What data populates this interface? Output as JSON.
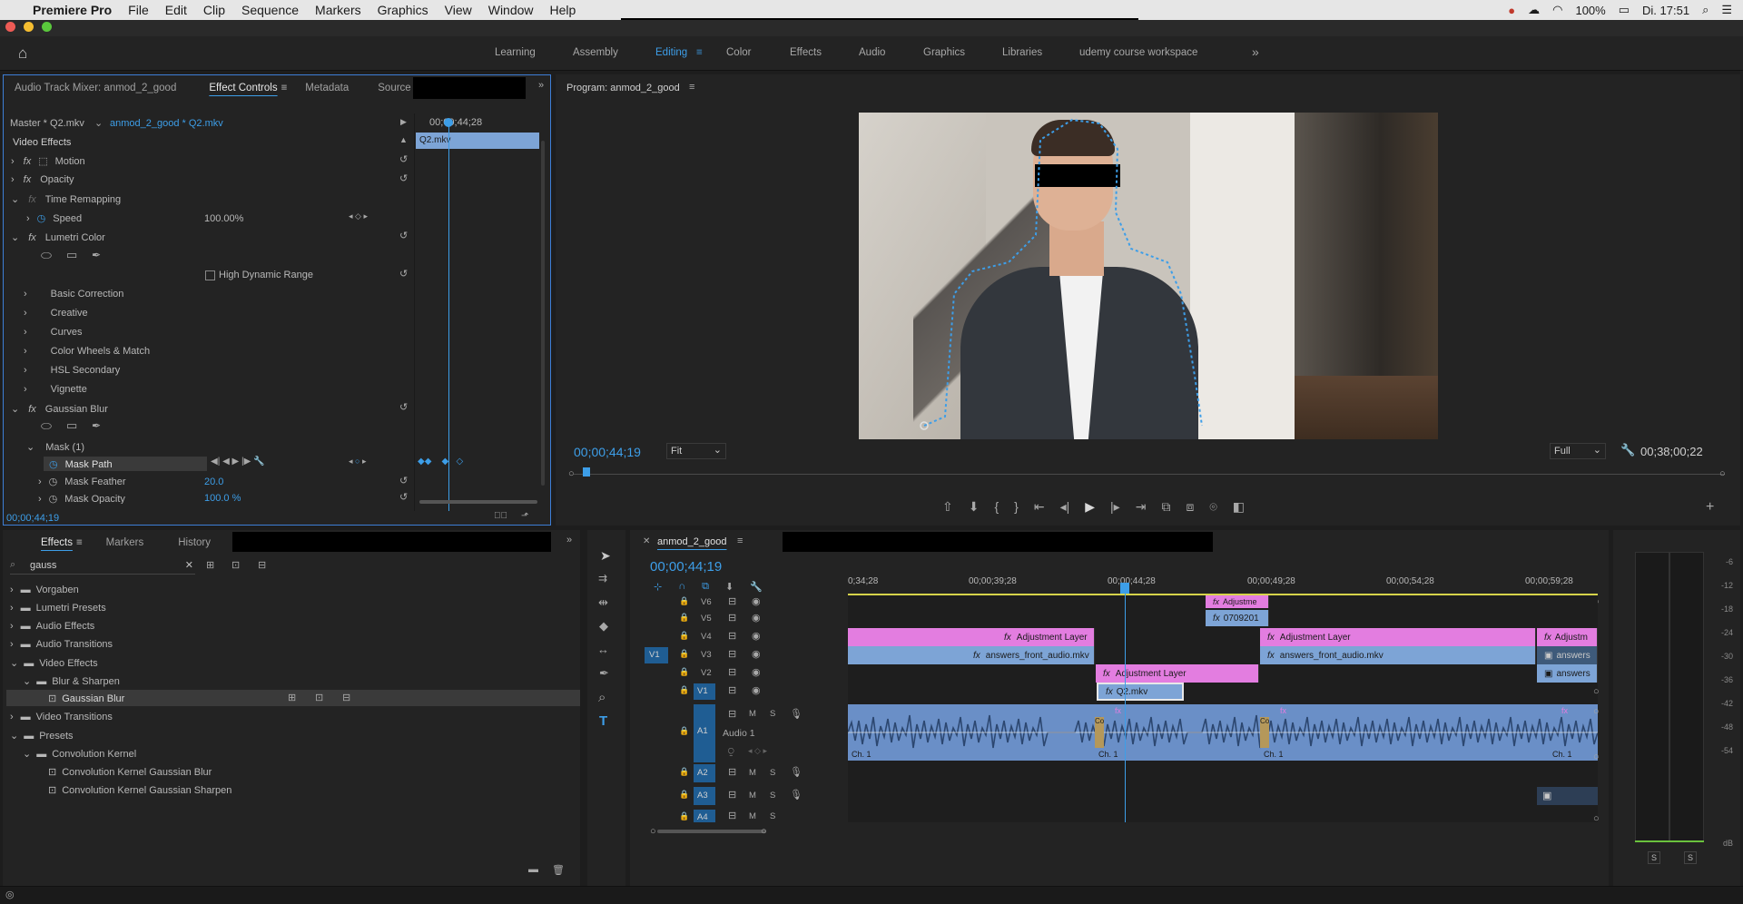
{
  "menubar": {
    "app_name": "Premiere Pro",
    "items": [
      "File",
      "Edit",
      "Clip",
      "Sequence",
      "Markers",
      "Graphics",
      "View",
      "Window",
      "Help"
    ],
    "battery": "100%",
    "clock": "Di. 17:51"
  },
  "workspaces": {
    "items": [
      "Learning",
      "Assembly",
      "Editing",
      "Color",
      "Effects",
      "Audio",
      "Graphics",
      "Libraries",
      "udemy course workspace"
    ],
    "active": "Editing",
    "more": "»"
  },
  "effect_controls": {
    "tabs": [
      "Audio Track Mixer: anmod_2_good",
      "Effect Controls",
      "Metadata",
      "Source"
    ],
    "master_label": "Master * Q2.mkv",
    "clip_label": "anmod_2_good * Q2.mkv",
    "timecode_ruler": "00;00;44;28",
    "clip_bar": "Q2.mkv",
    "section": "Video Effects",
    "rows": {
      "motion": "Motion",
      "opacity": "Opacity",
      "time_remap": "Time Remapping",
      "speed": "Speed",
      "speed_value": "100.00%",
      "lumetri": "Lumetri Color",
      "hdr": "High Dynamic Range",
      "basic": "Basic Correction",
      "creative": "Creative",
      "curves": "Curves",
      "wheels": "Color Wheels & Match",
      "hsl": "HSL Secondary",
      "vignette": "Vignette",
      "gaussian": "Gaussian Blur",
      "mask": "Mask (1)",
      "mask_path": "Mask Path",
      "mask_feather": "Mask Feather",
      "mask_feather_value": "20.0",
      "mask_opacity": "Mask Opacity",
      "mask_opacity_value": "100.0 %"
    },
    "bottom_timecode": "00;00;44;19"
  },
  "program": {
    "title": "Program: anmod_2_good",
    "timecode": "00;00;44;19",
    "fit": "Fit",
    "quality": "Full",
    "duration": "00;38;00;22"
  },
  "effects_panel": {
    "tabs": [
      "Effects",
      "Markers",
      "History"
    ],
    "search_value": "gauss",
    "tree": [
      {
        "label": "Vorgaben",
        "level": 0,
        "type": "folder"
      },
      {
        "label": "Lumetri Presets",
        "level": 0,
        "type": "folder"
      },
      {
        "label": "Audio Effects",
        "level": 0,
        "type": "folder"
      },
      {
        "label": "Audio Transitions",
        "level": 0,
        "type": "folder"
      },
      {
        "label": "Video Effects",
        "level": 0,
        "type": "folder",
        "open": true
      },
      {
        "label": "Blur & Sharpen",
        "level": 1,
        "type": "folder",
        "open": true
      },
      {
        "label": "Gaussian Blur",
        "level": 2,
        "type": "effect",
        "selected": true
      },
      {
        "label": "Video Transitions",
        "level": 0,
        "type": "folder"
      },
      {
        "label": "Presets",
        "level": 0,
        "type": "folder",
        "open": true
      },
      {
        "label": "Convolution Kernel",
        "level": 1,
        "type": "folder",
        "open": true
      },
      {
        "label": "Convolution Kernel Gaussian Blur",
        "level": 2,
        "type": "preset"
      },
      {
        "label": "Convolution Kernel Gaussian Sharpen",
        "level": 2,
        "type": "preset"
      }
    ]
  },
  "timeline": {
    "sequence_tab": "anmod_2_good",
    "timecode": "00;00;44;19",
    "ruler": [
      "0;34;28",
      "00;00;39;28",
      "00;00;44;28",
      "00;00;49;28",
      "00;00;54;28",
      "00;00;59;28"
    ],
    "tracks": {
      "video": [
        "V6",
        "V5",
        "V4",
        "V3",
        "V2",
        "V1"
      ],
      "audio": [
        "A1",
        "A2",
        "A3",
        "A4"
      ],
      "source_patch": "V1",
      "audio1_name": "Audio 1",
      "m": "M",
      "s": "S"
    },
    "clips": {
      "v6": "Adjustme",
      "v5": "0709201",
      "v4a": "Adjustment Layer",
      "v4b": "Adjustment Layer",
      "v4c": "Adjustm",
      "v3a": "answers_front_audio.mkv",
      "v3b": "answers_front_audio.mkv",
      "v3c": "answers",
      "v2a": "Adjustment Layer",
      "v2c": "answers",
      "v1": "Q2.mkv",
      "ch1": "Ch. 1",
      "co": "Co"
    }
  },
  "meters": {
    "labels": [
      "-6",
      "-12",
      "-18",
      "-24",
      "-30",
      "-36",
      "-42",
      "-48",
      "-54",
      "dB"
    ],
    "solo": "S"
  },
  "colors": {
    "accent": "#3d9ee8",
    "adjustment": "#e37de0",
    "video_clip": "#7da4d6",
    "audio_clip": "#6a8fc7"
  }
}
